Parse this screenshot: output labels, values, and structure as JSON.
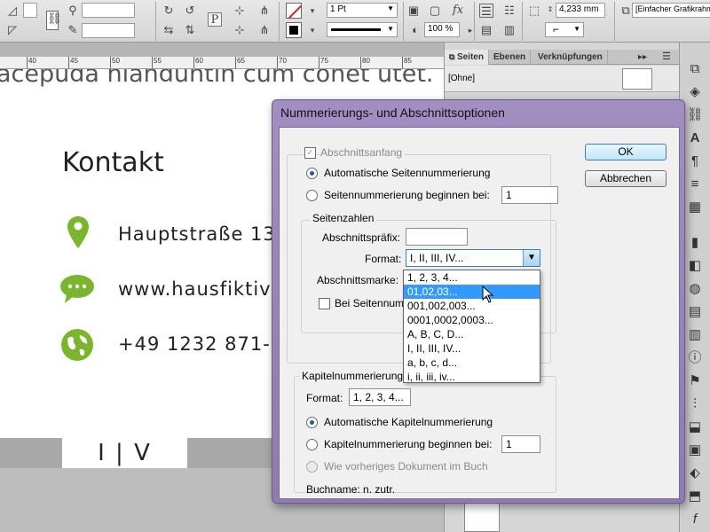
{
  "control_bar": {
    "stroke_weight": "1 Pt",
    "zoom": "100 %",
    "measure": "4,233 mm",
    "object_style": "[Einfacher Grafikrahmen]"
  },
  "ruler": {
    "ticks": [
      "40",
      "45",
      "50",
      "55",
      "60",
      "65",
      "70",
      "75",
      "80",
      "85"
    ]
  },
  "page": {
    "top_text": "acepuda nianduntin cum conet utet.",
    "heading": "Kontakt",
    "address": "Hauptstraße 13,",
    "website": "www.hausfiktiv.",
    "phone": "+49 1232 871-0",
    "footer_number": "I | V"
  },
  "panel": {
    "tabs": [
      "Seiten",
      "Ebenen",
      "Verknüpfungen"
    ],
    "master": "[Ohne]"
  },
  "dialog": {
    "title": "Nummerierungs- und Abschnittsoptionen",
    "section_start": "Abschnittsanfang",
    "auto_numbering": "Automatische Seitennummerierung",
    "start_numbering": "Seitennummerierung beginnen bei:",
    "start_value": "1",
    "page_numbers_group": "Seitenzahlen",
    "prefix_label": "Abschnittspräfix:",
    "prefix_value": "",
    "format_label": "Format:",
    "format_value": "I, II, III, IV...",
    "marker_label": "Abschnittsmarke:",
    "include_prefix": "Bei Seitennum",
    "chapter_group": "Kapitelnummerierung",
    "chapter_format_label": "Format:",
    "chapter_format_value": "1, 2, 3, 4...",
    "chapter_auto": "Automatische Kapitelnummerierung",
    "chapter_start": "Kapitelnummerierung beginnen bei:",
    "chapter_start_value": "1",
    "chapter_prev": "Wie vorheriges Dokument im Buch",
    "book_name": "Buchname: n. zutr.",
    "ok": "OK",
    "cancel": "Abbrechen",
    "format_options": [
      "1, 2, 3, 4...",
      "01,02,03...",
      "001,002,003...",
      "0001,0002,0003...",
      "A, B, C, D...",
      "I, II, III, IV...",
      "a, b, c, d...",
      "i, ii, iii, iv..."
    ],
    "selected_option_index": 1
  }
}
